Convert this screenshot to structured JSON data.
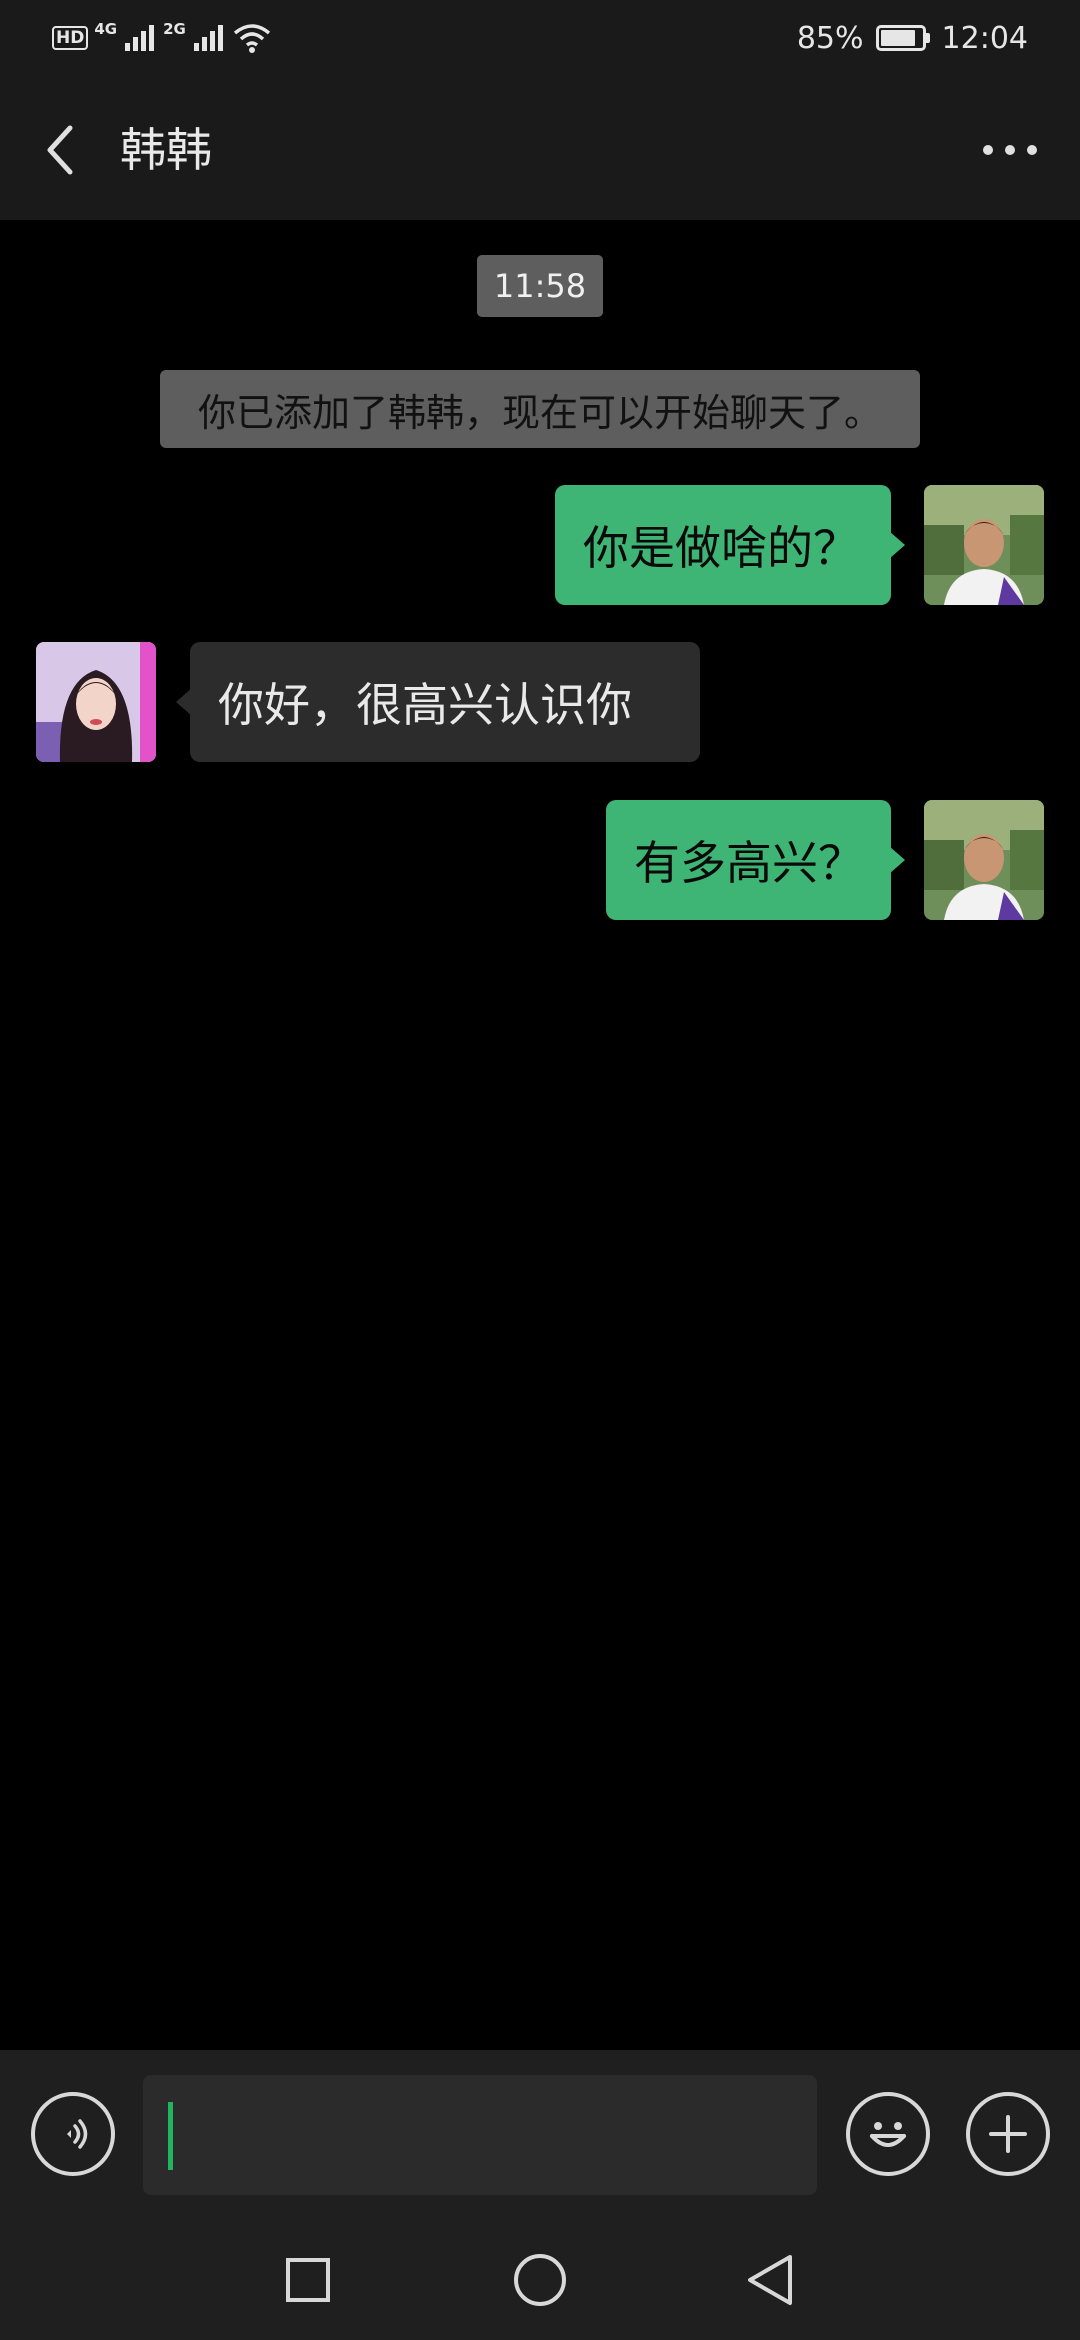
{
  "status_bar": {
    "hd_label": "HD",
    "network_1": "4G",
    "network_2": "2G",
    "battery_percent": "85%",
    "battery_level": 0.85,
    "time": "12:04"
  },
  "header": {
    "title": "韩韩",
    "back_icon": "chevron-left-icon",
    "more_icon": "more-dots-icon"
  },
  "chat": {
    "timestamp": "11:58",
    "system_message": "你已添加了韩韩，现在可以开始聊天了。",
    "messages": [
      {
        "direction": "out",
        "text": "你是做啥的？"
      },
      {
        "direction": "in",
        "text": "你好，很高兴认识你"
      },
      {
        "direction": "out",
        "text": "有多高兴？"
      }
    ]
  },
  "input_bar": {
    "voice_icon": "voice-icon",
    "text_value": "",
    "emoji_icon": "emoji-icon",
    "plus_icon": "plus-icon"
  },
  "nav_bar": {
    "recents_icon": "square-icon",
    "home_icon": "circle-icon",
    "back_icon": "triangle-back-icon"
  },
  "colors": {
    "outgoing_bubble": "#3eb575",
    "incoming_bubble": "#2c2c2c",
    "background": "#000000",
    "bars": "#1a1a1a",
    "cursor": "#23b35f"
  }
}
